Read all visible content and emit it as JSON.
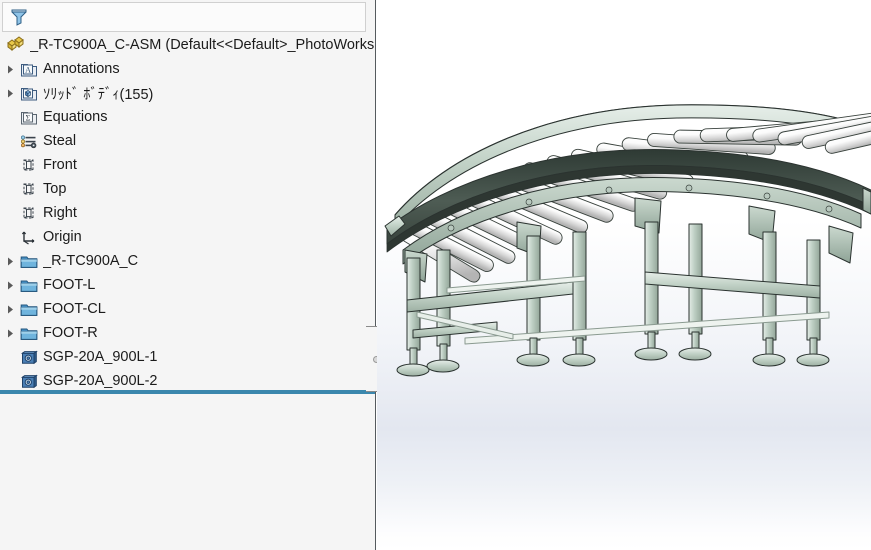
{
  "app": {
    "name": "SolidWorks Feature Manager",
    "accent_color": "#3b87ad",
    "panel_bg": "#f5f5f5"
  },
  "filter": {
    "icon": "funnel-filter-icon",
    "value": "",
    "placeholder": ""
  },
  "tree": {
    "root": {
      "label": "_R-TC900A_C-ASM  (Default<<Default>_PhotoWorks",
      "icon": "assembly-icon",
      "expandable": false
    },
    "items": [
      {
        "label": "Annotations",
        "icon": "annotations-folder-icon",
        "expandable": true,
        "indent": 1
      },
      {
        "label": "ｿﾘｯﾄﾞ ﾎﾞﾃﾞｨ(155)",
        "icon": "solid-bodies-folder-icon",
        "expandable": true,
        "indent": 1
      },
      {
        "label": "Equations",
        "icon": "equations-folder-icon",
        "expandable": false,
        "indent": 1
      },
      {
        "label": "Steal",
        "icon": "material-icon",
        "expandable": false,
        "indent": 1
      },
      {
        "label": "Front",
        "icon": "plane-icon",
        "expandable": false,
        "indent": 1
      },
      {
        "label": "Top",
        "icon": "plane-icon",
        "expandable": false,
        "indent": 1
      },
      {
        "label": "Right",
        "icon": "plane-icon",
        "expandable": false,
        "indent": 1
      },
      {
        "label": "Origin",
        "icon": "origin-icon",
        "expandable": false,
        "indent": 1
      },
      {
        "label": "_R-TC900A_C",
        "icon": "folder-icon",
        "expandable": true,
        "indent": 1
      },
      {
        "label": "FOOT-L",
        "icon": "folder-icon",
        "expandable": true,
        "indent": 1
      },
      {
        "label": "FOOT-CL",
        "icon": "folder-icon",
        "expandable": true,
        "indent": 1
      },
      {
        "label": "FOOT-R",
        "icon": "folder-icon",
        "expandable": true,
        "indent": 1
      },
      {
        "label": "SGP-20A_900L-1",
        "icon": "part-icon",
        "expandable": false,
        "indent": 1
      },
      {
        "label": "SGP-20A_900L-2",
        "icon": "part-icon",
        "expandable": false,
        "indent": 1
      }
    ],
    "rollback_bar": {
      "name": "rollback-bar",
      "color": "#3b87ad"
    }
  },
  "splitter": {
    "name": "panel-splitter",
    "handle": "drag-dot"
  },
  "viewport": {
    "name": "graphics-area",
    "model": "curved-roller-conveyor",
    "background_top": "#ffffff",
    "background_mid": "#e3e7f0",
    "frame_color": "#b6c7bd",
    "roller_color": "#f2f2f2",
    "edge_color": "#2b3330"
  }
}
